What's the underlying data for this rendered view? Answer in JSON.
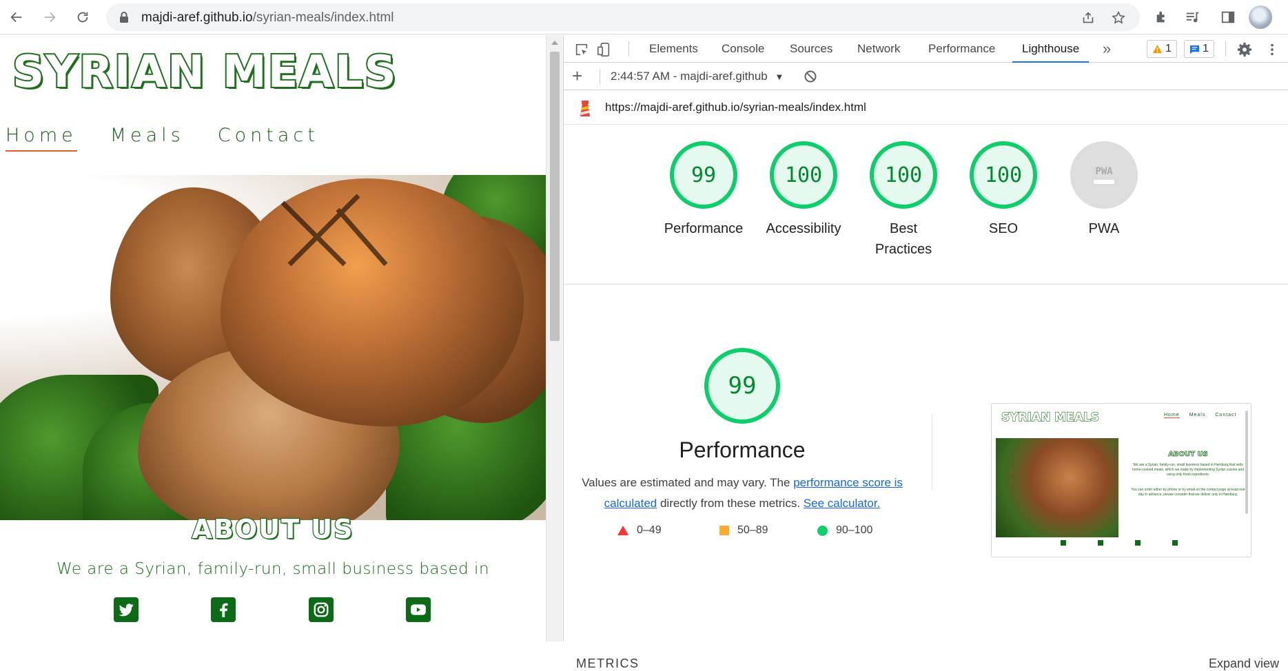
{
  "browser": {
    "url_host": "majdi-aref.github.io",
    "url_path": "/syrian-meals/index.html"
  },
  "site": {
    "logo": "SYRIAN MEALS",
    "nav": [
      "Home",
      "Meals",
      "Contact"
    ],
    "about_title": "ABOUT US",
    "about_text": "We are a Syrian, family-run, small business based in",
    "socials": [
      "twitter-icon",
      "facebook-icon",
      "instagram-icon",
      "youtube-icon"
    ]
  },
  "devtools": {
    "tabs": [
      "Elements",
      "Console",
      "Sources",
      "Network",
      "Performance",
      "Lighthouse"
    ],
    "more_tabs": "»",
    "warnings_count": "1",
    "messages_count": "1",
    "report_select": "2:44:57 AM - majdi-aref.github",
    "audited_url": "https://majdi-aref.github.io/syrian-meals/index.html"
  },
  "lighthouse": {
    "gauges": [
      {
        "score": "99",
        "label": "Performance"
      },
      {
        "score": "100",
        "label": "Accessibility"
      },
      {
        "score": "100",
        "label": "Best Practices"
      },
      {
        "score": "100",
        "label": "SEO"
      },
      {
        "score": "PWA",
        "label": "PWA"
      }
    ],
    "perf_score": "99",
    "perf_title": "Performance",
    "perf_desc_1": "Values are estimated and may vary. The ",
    "perf_link_1": "performance score is calculated",
    "perf_desc_2": " directly from these metrics. ",
    "perf_link_2": "See calculator.",
    "legend": [
      "0–49",
      "50–89",
      "90–100"
    ],
    "thumb": {
      "logo": "SYRIAN MEALS",
      "nav": [
        "Home",
        "Meals",
        "Contact"
      ],
      "about": "ABOUT US",
      "text1": "We are a Syrian, family-run, small business based in Hamburg that sells home-cooked meals, which we make by implementing Syrian cuisine and using only fresh ingredients.",
      "text2": "You can order either by phone or by email on the contact page at least one day in advance, please consider that we deliver only in Hamburg."
    },
    "metrics_header": "METRICS",
    "expand_view": "Expand view"
  },
  "colors": {
    "pass": "#0cce6b",
    "average": "#ffaa33",
    "fail": "#ff3333",
    "site_green": "#1f6f1f",
    "nav_accent": "#e35a2a",
    "devtools_accent": "#1a73e8"
  }
}
